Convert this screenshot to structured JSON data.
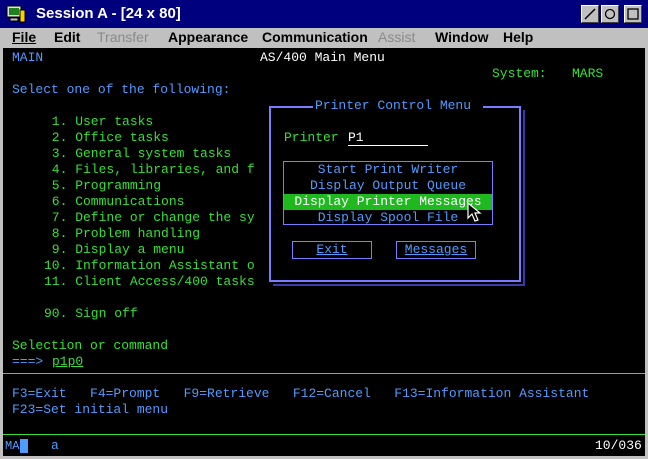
{
  "window": {
    "title": "Session A - [24 x 80]"
  },
  "menu": [
    {
      "label": "File",
      "disabled": false
    },
    {
      "label": "Edit",
      "disabled": false
    },
    {
      "label": "Transfer",
      "disabled": true
    },
    {
      "label": "Appearance",
      "disabled": false
    },
    {
      "label": "Communication",
      "disabled": false
    },
    {
      "label": "Assist",
      "disabled": true
    },
    {
      "label": "Window",
      "disabled": false
    },
    {
      "label": "Help",
      "disabled": false
    }
  ],
  "screen": {
    "menu_id": "MAIN",
    "title": "AS/400 Main Menu",
    "system_label": "System:",
    "system_value": "MARS",
    "prompt": "Select one of the following:",
    "options": [
      " 1. User tasks",
      " 2. Office tasks",
      " 3. General system tasks",
      " 4. Files, libraries, and f",
      " 5. Programming",
      " 6. Communications",
      " 7. Define or change the sy",
      " 8. Problem handling",
      " 9. Display a menu",
      "10. Information Assistant o",
      "11. Client Access/400 tasks"
    ],
    "signoff": "90. Sign off",
    "selection_label": "Selection or command",
    "command_arrow": "===>",
    "command_value": "p1p0",
    "fkeys_line1": "F3=Exit   F4=Prompt   F9=Retrieve   F12=Cancel   F13=Information Assistant",
    "fkeys_line2": "F23=Set initial menu"
  },
  "popup": {
    "title": "Printer Control Menu",
    "printer_label": "Printer",
    "printer_value": "P1",
    "options": [
      "Start Print Writer",
      "Display Output Queue",
      "Display Printer Messages",
      "Display Spool File"
    ],
    "exit_label": "Exit",
    "messages_label": "Messages"
  },
  "status": {
    "left": "MA",
    "mid": "a",
    "right": "10/036"
  },
  "colors": {
    "screen_bg": "#000000",
    "blue_text": "#4f9cff",
    "green_text": "#35e035",
    "highlight": "#1fb81f",
    "titlebar": "#00007f"
  }
}
